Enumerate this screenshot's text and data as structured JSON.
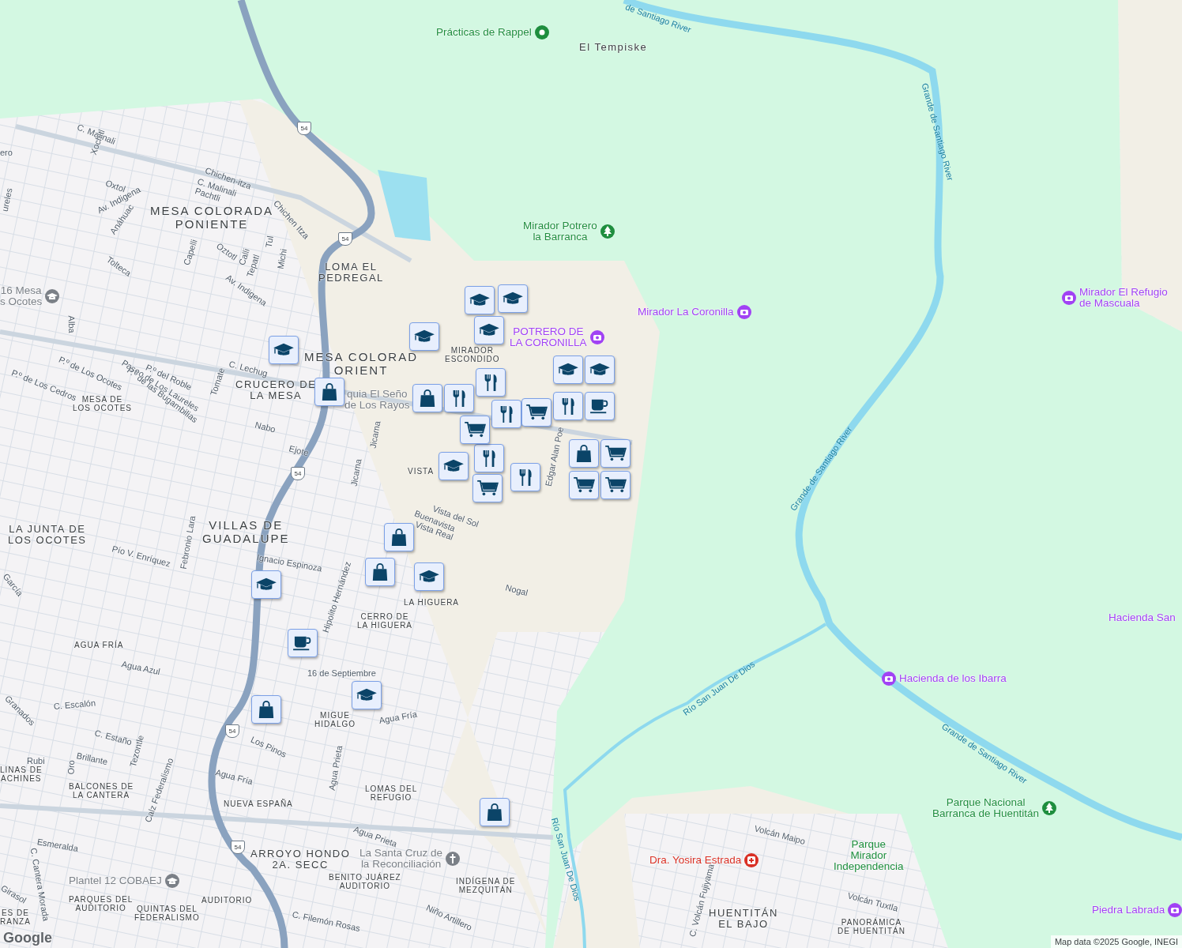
{
  "map": {
    "areas": [
      {
        "lines": [
          "El Tempiske"
        ]
      },
      {
        "lines": [
          "MESA COLORADA",
          "PONIENTE"
        ]
      },
      {
        "lines": [
          "LOMA EL",
          "PEDREGAL"
        ]
      },
      {
        "lines": [
          "MESA COLORAD",
          "ORIENT"
        ]
      },
      {
        "lines": [
          "CRUCERO DE",
          "LA MESA"
        ]
      },
      {
        "lines": [
          "MESA DE",
          "LOS OCOTES"
        ]
      },
      {
        "lines": [
          "MIRADOR",
          "ESCONDIDO"
        ]
      },
      {
        "lines": [
          "VISTA"
        ]
      },
      {
        "lines": [
          "LA JUNTA DE",
          "LOS OCOTES"
        ]
      },
      {
        "lines": [
          "VILLAS DE",
          "GUADALUPE"
        ]
      },
      {
        "lines": [
          "LA HIGUERA"
        ]
      },
      {
        "lines": [
          "CERRO DE",
          "LA HIGUERA"
        ]
      },
      {
        "lines": [
          "AGUA FRÍA"
        ]
      },
      {
        "lines": [
          "MIGUE",
          "HIDALGO"
        ]
      },
      {
        "lines": [
          "LINAS DE",
          "ACHINES"
        ]
      },
      {
        "lines": [
          "BALCONES DE",
          "LA CANTERA"
        ]
      },
      {
        "lines": [
          "NUEVA ESPAÑA"
        ]
      },
      {
        "lines": [
          "LOMAS DEL",
          "REFUGIO"
        ]
      },
      {
        "lines": [
          "ARROYO HONDO",
          "2A. SECC"
        ]
      },
      {
        "lines": [
          "BENITO JUÁREZ",
          "AUDITORIO"
        ]
      },
      {
        "lines": [
          "INDÍGENA DE",
          "MEZQUITÁN"
        ]
      },
      {
        "lines": [
          "PARQUES DEL",
          "AUDITORIO"
        ]
      },
      {
        "lines": [
          "QUINTAS DEL",
          "FEDERALISMO"
        ]
      },
      {
        "lines": [
          "AUDITORIO"
        ]
      },
      {
        "lines": [
          "ES DE",
          "RANZA"
        ]
      },
      {
        "lines": [
          "HUENTITÁN",
          "EL BAJO"
        ]
      },
      {
        "lines": [
          "PANORÁMICA",
          "DE HUENTITÁN"
        ]
      }
    ],
    "streets": [
      "C. Malinali",
      "Xochitl",
      "Oxtol",
      "Chichen-itza",
      "C. Malinali",
      "Pachtli",
      "Chichen Itza",
      "Av. Indigena",
      "Anáhuac",
      "Tolteca",
      "Oztotl",
      "Capelli",
      "Calli",
      "Tepatl",
      "Tul",
      "Michi",
      "Av. Indigena",
      "Alba",
      "P.º de Los Ocotes",
      "P.º de Los Cedros",
      "P.º del Roble",
      "Paseo de Los Laureles",
      "P.º de las Bugambilias",
      "C. Lechug",
      "Tomate",
      "Nabo",
      "Ejote",
      "Jicama",
      "Jicama",
      "Vista del Sol",
      "Buenavista",
      "Vista Real",
      "Edgar Alan Poe",
      "Pío V. Enríquez",
      "Febronio Lara",
      "Ignacio Espinoza",
      "Hipolito Hernández",
      "García",
      "Nogal",
      "Agua Azul",
      "16 de Septiembre",
      "Granados",
      "C. Escalón",
      "Agua Fría",
      "C. Estaño",
      "Los Pinos",
      "Brillante",
      "Tezontle",
      "Rubi",
      "Oro",
      "Agua Fría",
      "Calz Federalismo",
      "Agua Prieta",
      "Agua Prieta",
      "Esmeralda",
      "C. Cantera Morada",
      "Girasol",
      "C. Filemón Rosas",
      "Niño Artillero",
      "Volcán Maipo",
      "C. Volcán Fujiyama",
      "Volcán Tuxtla",
      "ero",
      "ureles"
    ],
    "water": [
      "de Santiago River",
      "Grande de Santiago River",
      "Grande de Santiago River",
      "Grande de Santiago River",
      "Río San Juan De Dios",
      "Río San Juan De Dios"
    ],
    "places": [
      {
        "kind": "point",
        "lines": [
          "Prácticas de Rappel"
        ],
        "color": "#1e8e3e"
      },
      {
        "kind": "park",
        "lines": [
          "Mirador Potrero",
          "la Barranca"
        ],
        "color": "#1e8e3e"
      },
      {
        "kind": "attraction",
        "lines": [
          "Mirador La Coronilla"
        ],
        "color": "#a142f4"
      },
      {
        "kind": "attraction",
        "lines": [
          "POTRERO DE",
          "LA CORONILLA"
        ],
        "color": "#a142f4"
      },
      {
        "kind": "attraction",
        "lines": [
          "Mirador El Refugio",
          "de Mascuala"
        ],
        "color": "#a142f4"
      },
      {
        "kind": "label",
        "lines": [
          "Hacienda San"
        ],
        "color": "#a142f4"
      },
      {
        "kind": "attraction",
        "lines": [
          "Hacienda de los Ibarra"
        ],
        "color": "#a142f4"
      },
      {
        "kind": "park",
        "lines": [
          "Parque Nacional",
          "Barranca de Huentitán"
        ],
        "color": "#1e8e3e"
      },
      {
        "kind": "medical",
        "lines": [
          "Dra. Yosira Estrada"
        ],
        "color": "#d93025"
      },
      {
        "kind": "label",
        "lines": [
          "Parque",
          "Mirador",
          "Independencia"
        ],
        "color": "#1e8e3e"
      },
      {
        "kind": "attraction",
        "lines": [
          "Piedra Labrada"
        ],
        "color": "#a142f4"
      },
      {
        "kind": "church",
        "lines": [
          "La Santa Cruz de",
          "la Reconciliación"
        ],
        "color": "#7b8087"
      },
      {
        "kind": "school",
        "lines": [
          "Plantel 12 COBAEJ"
        ],
        "color": "#7b8087"
      },
      {
        "kind": "school",
        "lines": [
          "16 Mesa",
          "s Ocotes"
        ],
        "color": "#7b8087"
      },
      {
        "kind": "label",
        "lines": [
          "quia El Seño",
          "de Los Rayos"
        ],
        "color": "#7b8087"
      }
    ],
    "shields": [
      "54",
      "54",
      "54",
      "54",
      "54"
    ],
    "markers": [
      {
        "kind": "school"
      },
      {
        "kind": "school"
      },
      {
        "kind": "school"
      },
      {
        "kind": "school"
      },
      {
        "kind": "school"
      },
      {
        "kind": "school"
      },
      {
        "kind": "school"
      },
      {
        "kind": "school"
      },
      {
        "kind": "school"
      },
      {
        "kind": "school"
      },
      {
        "kind": "school"
      },
      {
        "kind": "shopping"
      },
      {
        "kind": "shopping"
      },
      {
        "kind": "shopping"
      },
      {
        "kind": "shopping"
      },
      {
        "kind": "shopping"
      },
      {
        "kind": "shopping"
      },
      {
        "kind": "shopping"
      },
      {
        "kind": "restaurant"
      },
      {
        "kind": "restaurant"
      },
      {
        "kind": "restaurant"
      },
      {
        "kind": "restaurant"
      },
      {
        "kind": "restaurant"
      },
      {
        "kind": "restaurant"
      },
      {
        "kind": "grocery"
      },
      {
        "kind": "grocery"
      },
      {
        "kind": "grocery"
      },
      {
        "kind": "grocery"
      },
      {
        "kind": "grocery"
      },
      {
        "kind": "grocery"
      },
      {
        "kind": "cafe"
      },
      {
        "kind": "cafe"
      }
    ]
  },
  "attribution": "Map data ©2025 Google, INEGI",
  "logo": "Google"
}
